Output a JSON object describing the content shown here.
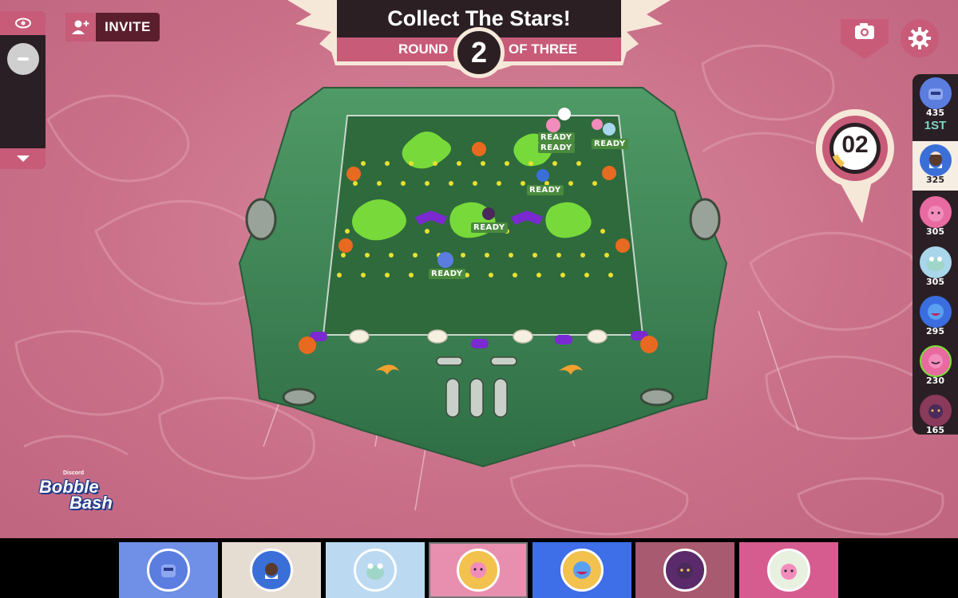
{
  "header": {
    "title": "Collect The Stars!",
    "round_word": "ROUND",
    "round_number": "2",
    "round_suffix": "OF THREE"
  },
  "invite": {
    "label": "INVITE"
  },
  "timer": {
    "value": "02"
  },
  "scoreboard": [
    {
      "score": "435",
      "rank": "1ST",
      "color": "#5b7de0"
    },
    {
      "score": "325",
      "color": "#d8cfc4",
      "is_me": true
    },
    {
      "score": "305",
      "color": "#e86aa0"
    },
    {
      "score": "305",
      "color": "#a9d6ea"
    },
    {
      "score": "295",
      "color": "#3a6ee0"
    },
    {
      "score": "230",
      "color": "#e86aa0"
    },
    {
      "score": "165",
      "color": "#8a3a5a"
    }
  ],
  "ready_tags": [
    "READY",
    "READY",
    "READY",
    "READY",
    "READY",
    "READY"
  ],
  "logo": {
    "brand": "Discord",
    "line1": "Bobble",
    "line2": "Bash"
  },
  "bottom_tiles": [
    {
      "bg": "#6f90e6",
      "face": "#5b7de0"
    },
    {
      "bg": "#e6ddd2",
      "face": "#3b6fd8"
    },
    {
      "bg": "#bcd9f2",
      "face": "#9fd6c8"
    },
    {
      "bg": "#e88fb0",
      "face": "#f2c14e",
      "selected": true
    },
    {
      "bg": "#3e6ee8",
      "face": "#3a6ee0"
    },
    {
      "bg": "#a85a70",
      "face": "#5a2a6a"
    },
    {
      "bg": "#d65c90",
      "face": "#e86aa0"
    }
  ],
  "colors": {
    "accent": "#c75b78",
    "dark": "#2a1f24",
    "board_green": "#3f8a55",
    "slime": "#7be03a"
  }
}
